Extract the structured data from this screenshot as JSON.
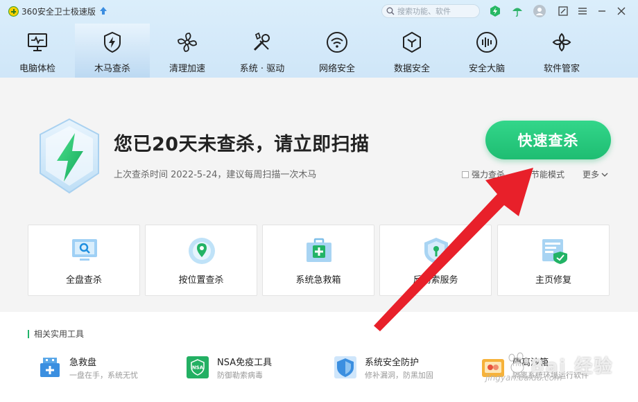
{
  "app": {
    "title": "360安全卫士极速版"
  },
  "search": {
    "placeholder": "搜索功能、软件"
  },
  "nav": {
    "items": [
      {
        "label": "电脑体检",
        "icon": "monitor-pulse-icon",
        "active": false
      },
      {
        "label": "木马查杀",
        "icon": "shield-bolt-icon",
        "active": true
      },
      {
        "label": "清理加速",
        "icon": "fan-icon",
        "active": false
      },
      {
        "label": "系统 · 驱动",
        "icon": "wrench-screwdriver-icon",
        "active": false
      },
      {
        "label": "网络安全",
        "icon": "wifi-icon",
        "active": false
      },
      {
        "label": "数据安全",
        "icon": "data-cube-icon",
        "active": false
      },
      {
        "label": "安全大脑",
        "icon": "brain-icon",
        "active": false
      },
      {
        "label": "软件管家",
        "icon": "software-grid-icon",
        "active": false
      }
    ]
  },
  "hero": {
    "headline": "您已20天未查杀，请立即扫描",
    "subline": "上次查杀时间 2022-5-24，建议每周扫描一次木马",
    "scan_button": "快速查杀",
    "options": [
      {
        "label": "强力查杀"
      },
      {
        "label": "节能模式"
      }
    ],
    "more_label": "更多"
  },
  "cards": [
    {
      "label": "全盘查杀",
      "icon": "full-disk-scan-icon"
    },
    {
      "label": "按位置查杀",
      "icon": "location-scan-icon"
    },
    {
      "label": "系统急救箱",
      "icon": "first-aid-kit-icon"
    },
    {
      "label": "反勒索服务",
      "icon": "anti-ransom-icon"
    },
    {
      "label": "主页修复",
      "icon": "homepage-repair-icon"
    }
  ],
  "tools": {
    "title": "相关实用工具",
    "items": [
      {
        "name": "急救盘",
        "desc": "一盘在手，系统无忧",
        "icon": "usb-rescue-icon"
      },
      {
        "name": "NSA免疫工具",
        "desc": "防御勒索病毒",
        "icon": "nsa-shield-icon",
        "icon_text": "NSA"
      },
      {
        "name": "系统安全防护",
        "desc": "修补漏洞，防黑加固",
        "icon": "system-protect-icon"
      },
      {
        "name": "隔离沙箱",
        "desc": "隔离系统环境运行软件",
        "icon": "sandbox-icon"
      }
    ]
  },
  "watermark": {
    "text": "Bai 经验",
    "sub": "jingyan.baidu.com"
  },
  "colors": {
    "accent_green": "#1ebd72",
    "nav_active": "#bcd9f2",
    "arrow_red": "#e8202a"
  }
}
